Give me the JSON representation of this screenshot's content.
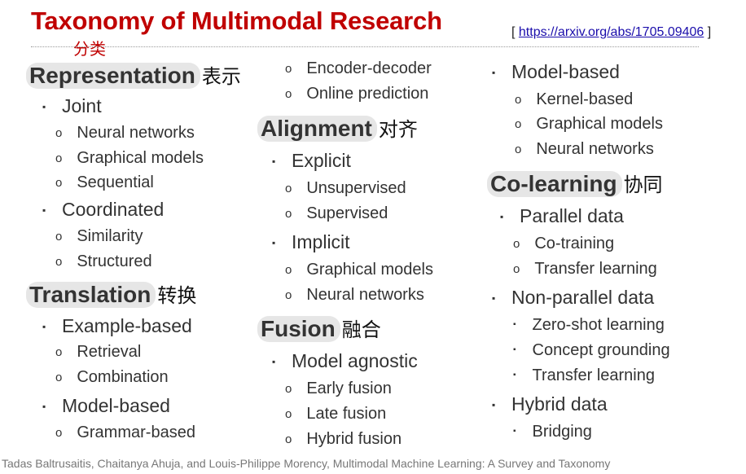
{
  "title": "Taxonomy of Multimodal Research",
  "title_cn": "分类",
  "reference": {
    "open": "[",
    "link": "https://arxiv.org/abs/1705.09406",
    "close": "]"
  },
  "bullets": {
    "square": "▪",
    "circle": "o"
  },
  "representation": {
    "heading": "Representation",
    "heading_cn": "表示",
    "joint": "Joint",
    "joint_items": [
      "Neural networks",
      "Graphical models",
      "Sequential"
    ],
    "coordinated": "Coordinated",
    "coordinated_items": [
      "Similarity",
      "Structured"
    ]
  },
  "translation": {
    "heading": "Translation",
    "heading_cn": "转换",
    "example": "Example-based",
    "example_items": [
      "Retrieval",
      "Combination"
    ],
    "model": "Model-based",
    "model_items": [
      "Grammar-based",
      "Encoder-decoder",
      "Online prediction"
    ]
  },
  "alignment": {
    "heading": "Alignment",
    "heading_cn": "对齐",
    "explicit": "Explicit",
    "explicit_items": [
      "Unsupervised",
      "Supervised"
    ],
    "implicit": "Implicit",
    "implicit_items": [
      "Graphical models",
      "Neural networks"
    ]
  },
  "fusion": {
    "heading": "Fusion",
    "heading_cn": "融合",
    "agnostic": "Model agnostic",
    "agnostic_items": [
      "Early fusion",
      "Late fusion",
      "Hybrid fusion"
    ],
    "model": "Model-based",
    "model_items": [
      "Kernel-based",
      "Graphical models",
      "Neural networks"
    ]
  },
  "colearning": {
    "heading": "Co-learning",
    "heading_cn": "协同",
    "parallel": "Parallel data",
    "parallel_items": [
      "Co-training",
      "Transfer learning"
    ],
    "nonparallel": "Non-parallel data",
    "nonparallel_items": [
      "Zero-shot learning",
      "Concept grounding",
      "Transfer learning"
    ],
    "hybrid": "Hybrid data",
    "hybrid_items": [
      "Bridging"
    ]
  },
  "footer": "Tadas Baltrusaitis, Chaitanya Ahuja, and Louis-Philippe Morency, Multimodal Machine Learning: A Survey and Taxonomy"
}
